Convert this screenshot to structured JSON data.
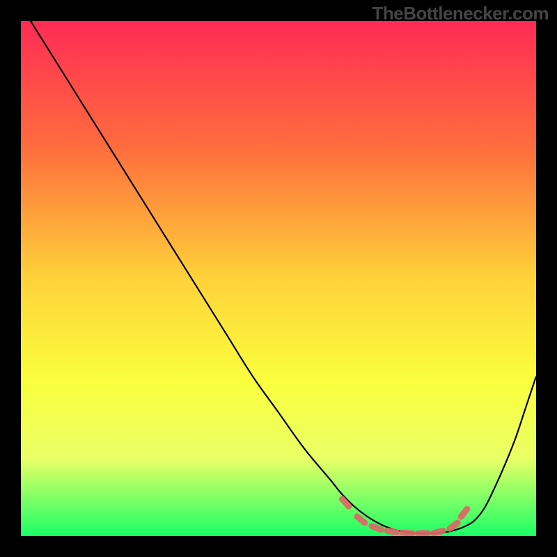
{
  "attribution": "TheBottlenecker.com",
  "chart_data": {
    "type": "line",
    "title": "",
    "xlabel": "",
    "ylabel": "",
    "xlim": [
      0,
      100
    ],
    "ylim": [
      0,
      100
    ],
    "background_gradient": {
      "stops": [
        {
          "offset": 0,
          "color": "#ff2b55"
        },
        {
          "offset": 25,
          "color": "#ff6e3d"
        },
        {
          "offset": 50,
          "color": "#ffd23a"
        },
        {
          "offset": 70,
          "color": "#faff3e"
        },
        {
          "offset": 85,
          "color": "#e9ff66"
        },
        {
          "offset": 100,
          "color": "#1aff66"
        }
      ]
    },
    "series": [
      {
        "name": "bottleneck-curve",
        "x": [
          0,
          5,
          10,
          15,
          20,
          25,
          30,
          35,
          40,
          45,
          50,
          55,
          60,
          62,
          64,
          66,
          68,
          70,
          72,
          74,
          76,
          78,
          80,
          82,
          84,
          86,
          88,
          90,
          92,
          94,
          96,
          98,
          100
        ],
        "y": [
          103,
          95,
          87,
          79,
          71,
          63,
          55,
          47,
          39,
          31,
          24,
          17,
          11,
          8.5,
          6.4,
          4.7,
          3.3,
          2.2,
          1.4,
          0.9,
          0.6,
          0.5,
          0.5,
          0.7,
          1.1,
          1.8,
          3.0,
          5.5,
          9.5,
          14,
          19,
          25,
          31
        ]
      }
    ],
    "markers": {
      "name": "highlight-band",
      "color": "#e06666",
      "points": [
        {
          "x": 63,
          "y": 6.5
        },
        {
          "x": 66,
          "y": 3.2
        },
        {
          "x": 69,
          "y": 1.6
        },
        {
          "x": 72,
          "y": 0.9
        },
        {
          "x": 75,
          "y": 0.6
        },
        {
          "x": 78,
          "y": 0.55
        },
        {
          "x": 81,
          "y": 0.8
        },
        {
          "x": 84,
          "y": 2.0
        },
        {
          "x": 86,
          "y": 4.5
        }
      ]
    }
  }
}
